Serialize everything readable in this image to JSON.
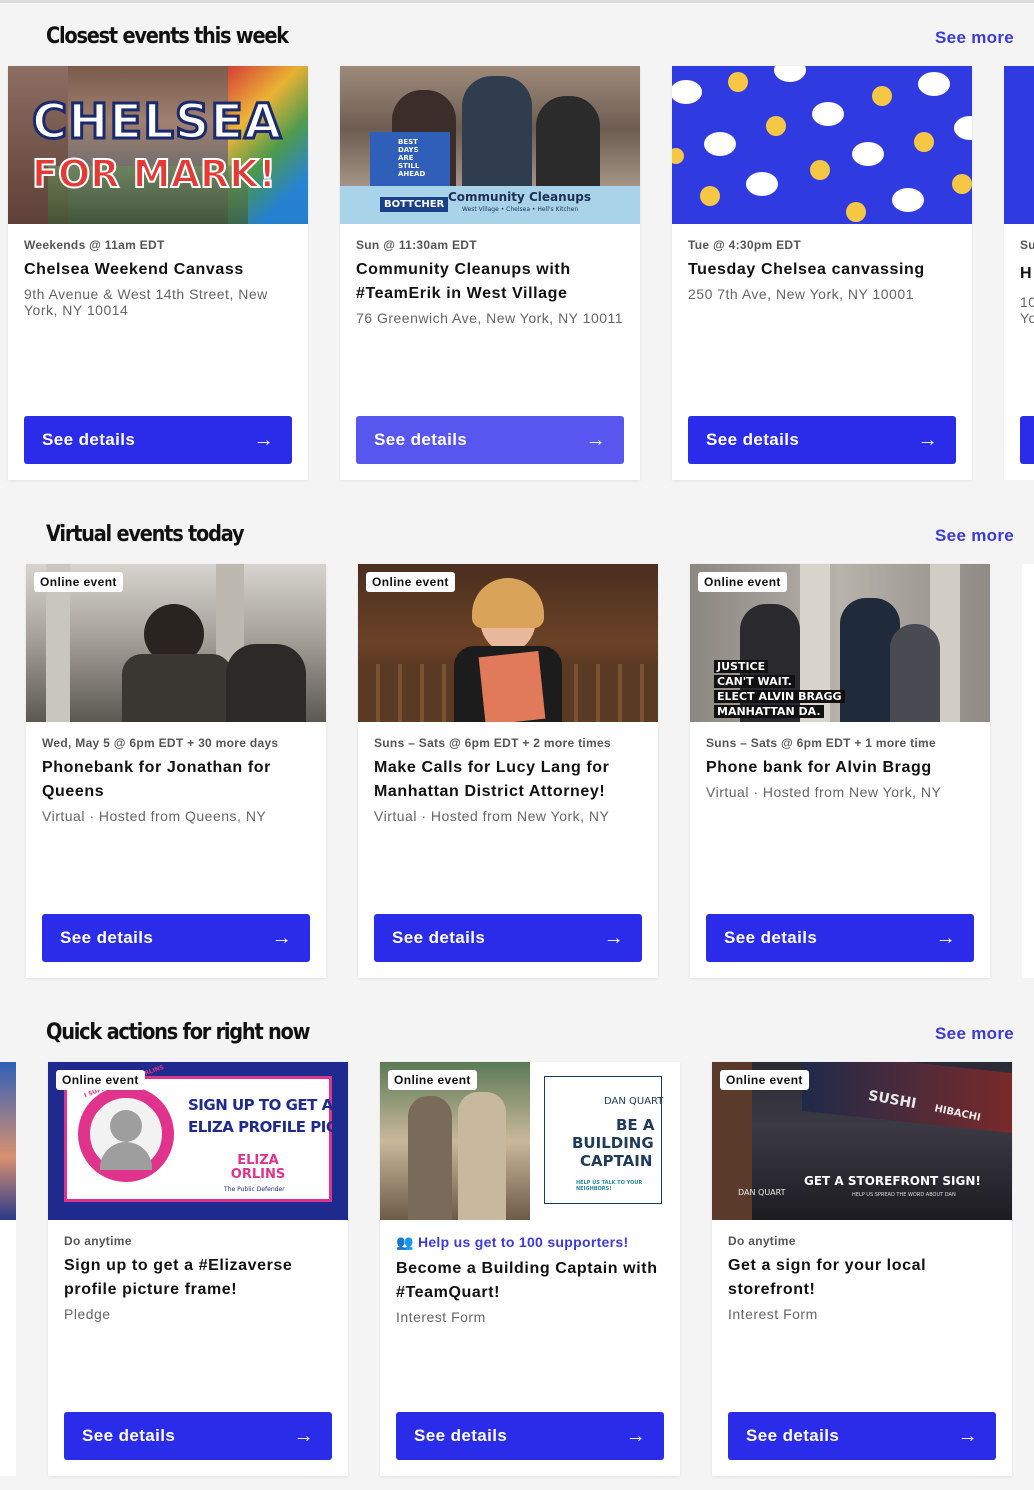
{
  "sections": [
    {
      "title": "Closest events this week",
      "see_more": "See more",
      "cards": [
        {
          "meta": "Weekends @ 11am EDT",
          "title": "Chelsea Weekend Canvass",
          "address": "9th Avenue & West 14th Street, New York, NY 10014",
          "button": "See details",
          "image_text_1": "CHELSEA",
          "image_text_2": "FOR MARK!"
        },
        {
          "meta": "Sun @ 11:30am EDT",
          "title": "Community Cleanups with #TeamErik in West Village",
          "address": "76 Greenwich Ave, New York, NY 10011",
          "button": "See details",
          "image_text_1": "BOTTCHER",
          "image_text_2": "Community Cleanups",
          "image_text_3": "West Village • Chelsea • Hell's Kitchen",
          "image_text_4": "BEST DAYS ARE STILL AHEAD"
        },
        {
          "meta": "Tue @ 4:30pm EDT",
          "title": "Tuesday Chelsea canvassing",
          "address": "250 7th Ave, New York, NY 10001",
          "button": "See details"
        }
      ],
      "peek": {
        "meta": "Su",
        "title": "H",
        "address": "10 Yo"
      }
    },
    {
      "title": "Virtual events today",
      "see_more": "See more",
      "cards": [
        {
          "badge": "Online event",
          "meta": "Wed, May 5 @ 6pm EDT + 30 more days",
          "title": "Phonebank for Jonathan for Queens",
          "address": "Virtual · Hosted from Queens, NY",
          "button": "See details"
        },
        {
          "badge": "Online event",
          "meta": "Suns – Sats @ 6pm EDT + 2 more times",
          "title": "Make Calls for Lucy Lang for Manhattan District Attorney!",
          "address": "Virtual · Hosted from New York, NY",
          "button": "See details"
        },
        {
          "badge": "Online event",
          "meta": "Suns – Sats @ 6pm EDT + 1 more time",
          "title": "Phone bank for Alvin Bragg",
          "address": "Virtual · Hosted from New York, NY",
          "button": "See details",
          "image_text": [
            "JUSTICE",
            "CAN'T WAIT.",
            "ELECT ALVIN BRAGG",
            "MANHATTAN DA."
          ]
        }
      ]
    },
    {
      "title": "Quick actions for right now",
      "see_more": "See more",
      "cards": [
        {
          "badge": "Online event",
          "meta": "Do anytime",
          "title": "Sign up to get a #Elizaverse profile picture frame!",
          "address": "Pledge",
          "button": "See details",
          "image_text_1": "SIGN UP TO GET AN",
          "image_text_2": "ELIZA PROFILE PIC!",
          "image_text_3": "I SUPPORT ELIZA ORLINS",
          "image_text_4": "ELIZA ORLINS",
          "image_text_5": "The Public Defender"
        },
        {
          "badge": "Online event",
          "meta": "Help us get to 100 supporters!",
          "title": "Become a Building Captain with #TeamQuart!",
          "address": "Interest Form",
          "button": "See details",
          "image_text_1": "DAN QUART",
          "image_text_2": "BE A",
          "image_text_3": "BUILDING",
          "image_text_4": "CAPTAIN",
          "image_text_5": "HELP US TALK TO YOUR NEIGHBORS!"
        },
        {
          "badge": "Online event",
          "meta": "Do anytime",
          "title": "Get a sign for your local storefront!",
          "address": "Interest Form",
          "button": "See details",
          "image_text_1": "GET A STOREFRONT SIGN!",
          "image_text_2": "HELP US SPREAD THE WORD ABOUT DAN",
          "image_text_3": "SUSHI",
          "image_text_4": "HIBACHI",
          "image_text_5": "DAN QUART"
        }
      ]
    }
  ],
  "colors": {
    "accent": "#2b2bea",
    "link": "#3b3bd9",
    "background": "#f4f4f4"
  },
  "icons": {
    "button_arrow": "arrow-right-icon",
    "supporters": "users-icon"
  }
}
